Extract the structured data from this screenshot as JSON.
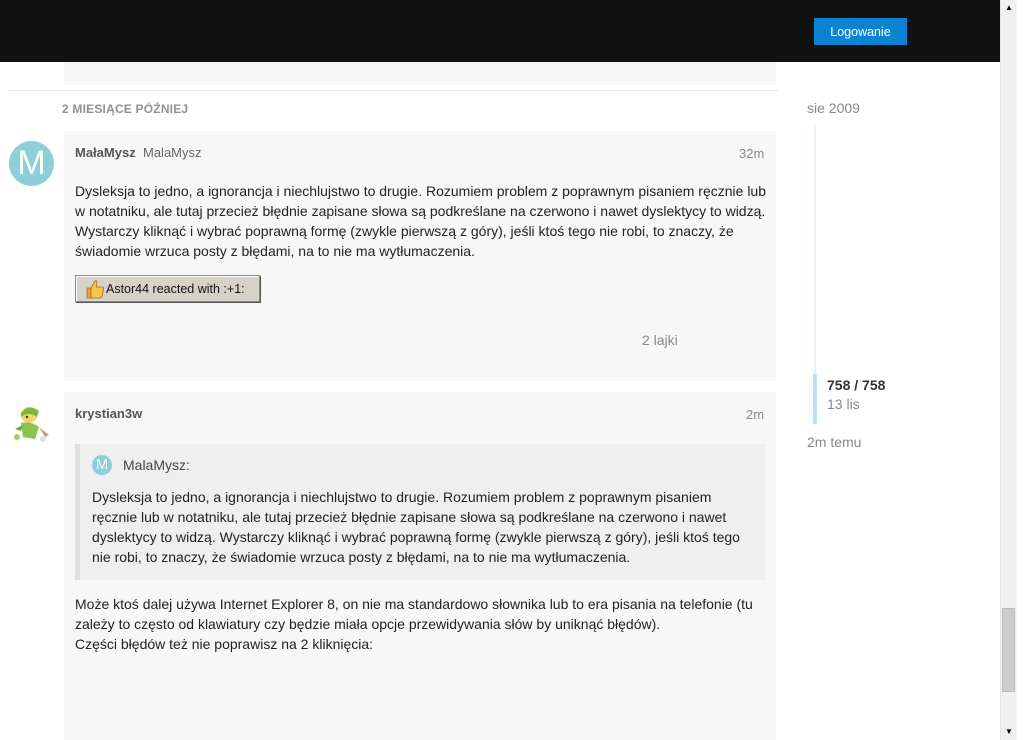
{
  "header": {
    "login_label": "Logowanie"
  },
  "time_gap": "2 MIESIĄCE PÓŹNIEJ",
  "post1": {
    "avatar_letter": "M",
    "username": "MałaMysz",
    "full_name": "MalaMysz",
    "date": "32m",
    "lines": [
      "Dysleksja to jedno, a ignorancja i niechlujstwo to drugie. Rozumiem problem z poprawnym pisaniem ręcznie lub",
      "w notatniku, ale tutaj przecież błędnie zapisane słowa są podkreślane na czerwono i nawet dyslektycy to widzą.",
      "Wystarczy kliknąć i wybrać poprawną formę (zwykle pierwszą z góry), jeśli ktoś tego nie robi, to znaczy, że",
      "świadomie wrzuca posty z błędami, na to nie ma wytłumaczenia."
    ],
    "reaction_label": "Astor44 reacted with :+1:",
    "likes": "2 lajki"
  },
  "post2": {
    "username": "krystian3w",
    "date": "2m",
    "quote": {
      "avatar_letter": "M",
      "author": "MalaMysz:",
      "lines": [
        "Dysleksja to jedno, a ignorancja i niechlujstwo to drugie. Rozumiem problem z poprawnym pisaniem",
        "ręcznie lub w notatniku, ale tutaj przecież błędnie zapisane słowa są podkreślane na czerwono i nawet",
        "dyslektycy to widzą. Wystarczy kliknąć i wybrać poprawną formę (zwykle pierwszą z góry), jeśli ktoś tego",
        "nie robi, to znaczy, że świadomie wrzuca posty z błędami, na to nie ma wytłumaczenia."
      ]
    },
    "lines": [
      "Może ktoś dalej używa Internet Explorer 8, on nie ma standardowo słownika lub to era pisania na telefonie (tu",
      "zależy to często od klawiatury czy będzie miała opcje przewidywania słów by uniknąć błędów).",
      "Części błędów też nie poprawisz na 2 kliknięcia:"
    ]
  },
  "timeline": {
    "start": "sie 2009",
    "count": "758 / 758",
    "current_date": "13 lis",
    "end": "2m temu"
  },
  "colors": {
    "accent": "#0a84d0",
    "avatar": "#8ccfd9",
    "header": "#111111"
  }
}
